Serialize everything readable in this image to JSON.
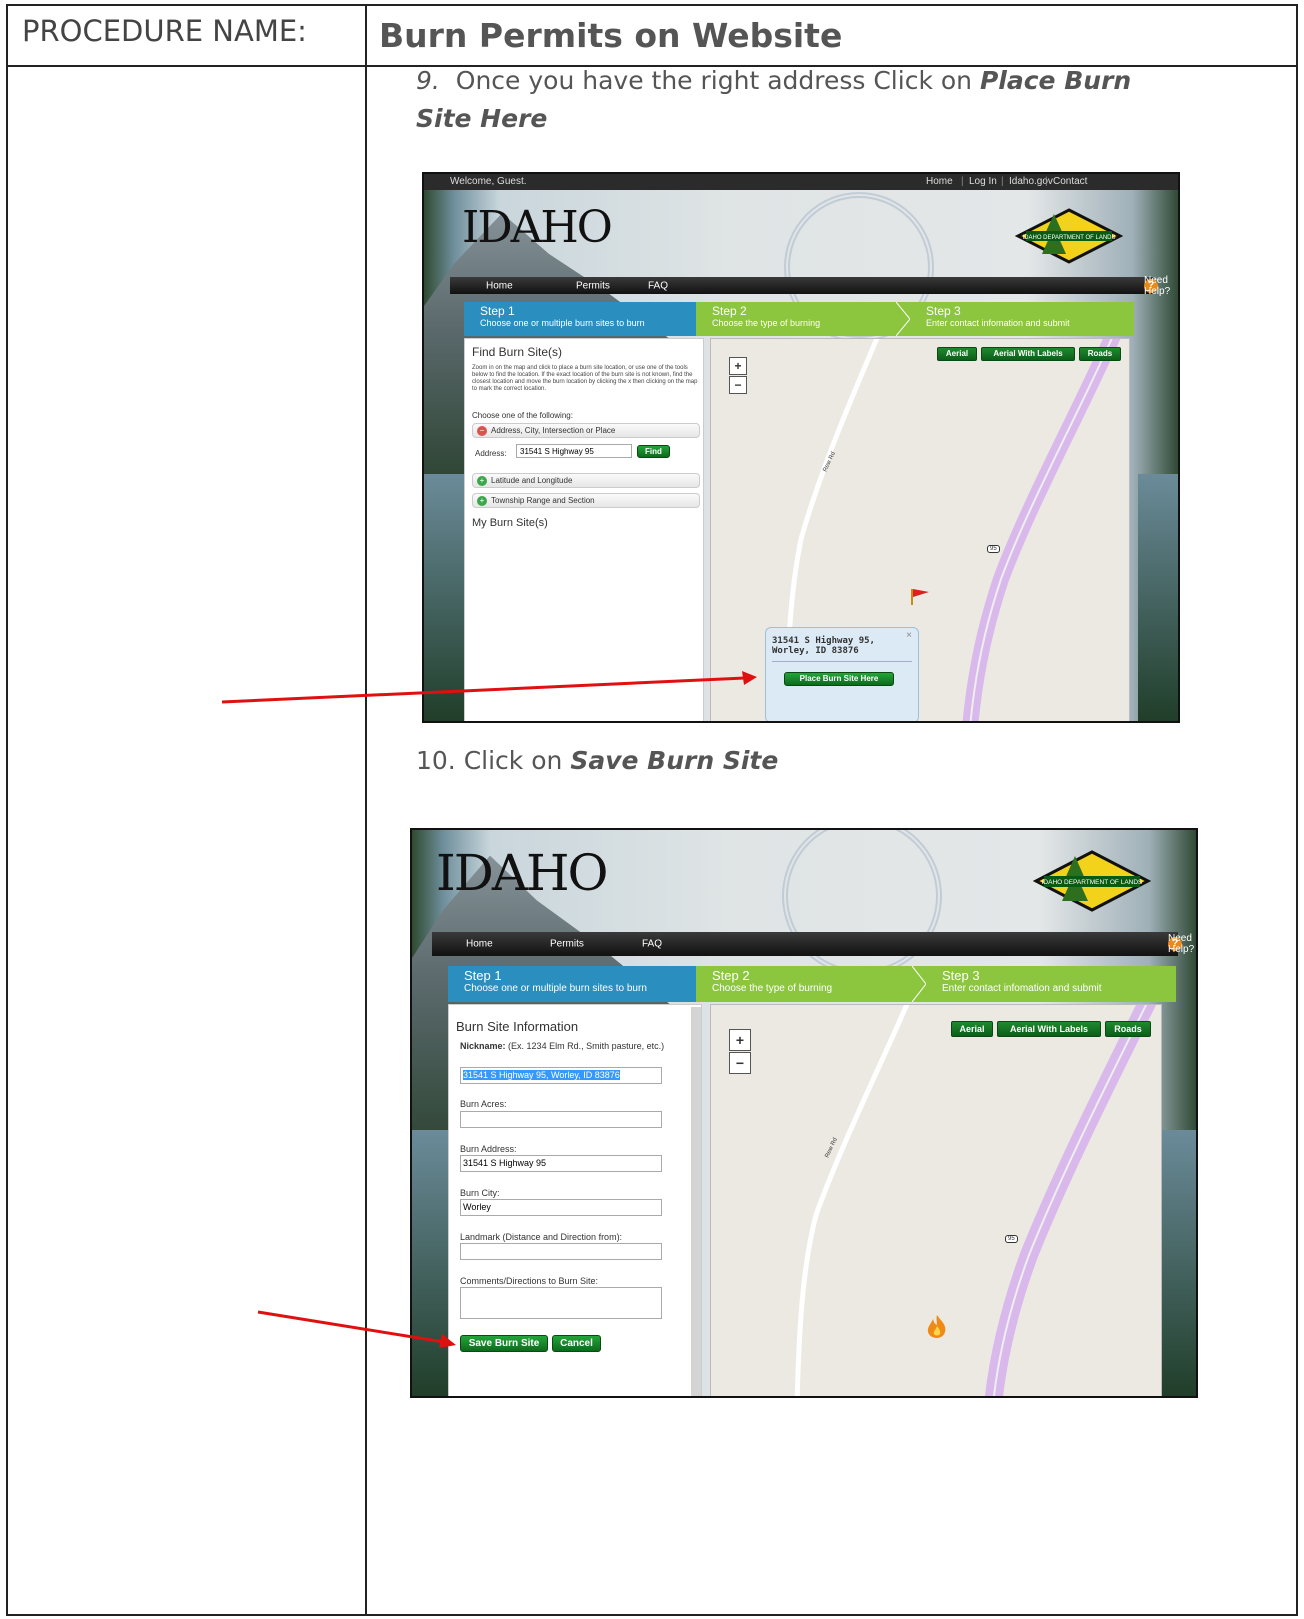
{
  "document": {
    "procedure_label": "PROCEDURE NAME:",
    "procedure_title": "Burn Permits on Website",
    "step9": {
      "num": "9.",
      "text": "Once you have the right address Click on ",
      "bold": "Place Burn Site Here"
    },
    "step10": {
      "text": "10. Click on ",
      "bold": "Save Burn Site"
    }
  },
  "site": {
    "welcome": "Welcome, Guest.",
    "top_links": [
      "Home",
      "Log In",
      "Idaho.gov",
      "Contact"
    ],
    "logo_text": "IDAHO",
    "dept_logo_text": "IDAHO DEPARTMENT OF LANDS",
    "nav": [
      "Home",
      "Permits",
      "FAQ"
    ],
    "help": "Need Help?",
    "help_icon": "?",
    "steps": [
      {
        "title": "Step 1",
        "sub": "Choose one or multiple burn sites to burn"
      },
      {
        "title": "Step 2",
        "sub": "Choose the type of burning"
      },
      {
        "title": "Step 3",
        "sub": "Enter contact infomation and submit"
      }
    ],
    "map_buttons": [
      "Aerial",
      "Aerial With Labels",
      "Roads"
    ],
    "zoom_in": "+",
    "zoom_out": "−",
    "road_label": "Rew Rd",
    "highway_shield": "95"
  },
  "shot1": {
    "panel_title": "Find Burn Site(s)",
    "instructions": "Zoom in on the map and click to place a burn site location, or use one of the tools below to find the location. If the exact location of the burn site is not known, find the closest location and move the burn location by clicking the x then clicking on the map to mark the correct location.",
    "choose": "Choose one of the following:",
    "acc_address": "Address, City, Intersection or Place",
    "address_label": "Address:",
    "address_value": "31541 S Highway 95",
    "find": "Find",
    "acc_latlong": "Latitude and Longitude",
    "acc_township": "Township Range and Section",
    "my_sites": "My Burn Site(s)",
    "popup_address_1": "31541 S Highway 95,",
    "popup_address_2": "Worley, ID 83876",
    "popup_close": "×",
    "place_btn": "Place Burn Site Here"
  },
  "shot2": {
    "panel_title": "Burn Site Information",
    "nickname_label": "Nickname:",
    "nickname_hint": "(Ex. 1234 Elm Rd., Smith pasture, etc.)",
    "nickname_value": "31541 S Highway 95, Worley, ID 83876",
    "acres_label": "Burn Acres:",
    "acres_value": "",
    "address_label": "Burn Address:",
    "address_value": "31541 S Highway 95",
    "city_label": "Burn City:",
    "city_value": "Worley",
    "landmark_label": "Landmark (Distance and Direction from):",
    "landmark_value": "",
    "comments_label": "Comments/Directions to Burn Site:",
    "comments_value": "",
    "save_btn": "Save Burn Site",
    "cancel_btn": "Cancel",
    "fire_icon": "fire-icon"
  },
  "colors": {
    "step_blue": "#2a8fbf",
    "step_green": "#8cc63f",
    "button_green": "#0d6b1c",
    "arrow_red": "#e01010",
    "highway_lilac": "#d9b8ec"
  }
}
